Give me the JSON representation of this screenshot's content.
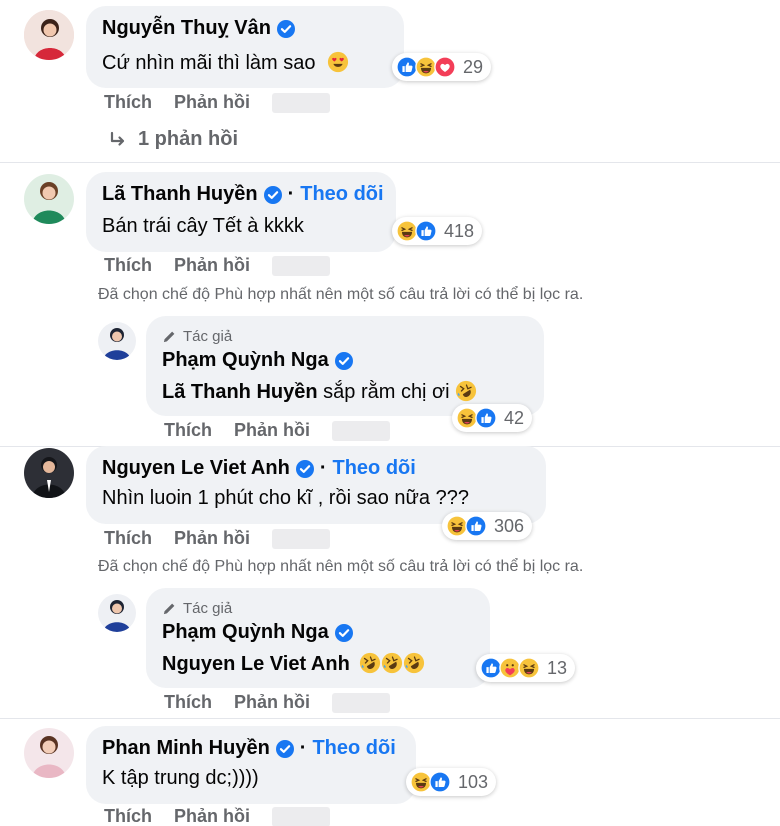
{
  "colors": {
    "accent": "#1877f2",
    "bubble": "#f0f2f5",
    "muted": "#65676b"
  },
  "actions": {
    "like": "Thích",
    "reply": "Phản hồi"
  },
  "filter_note": "Đã chọn chế độ Phù hợp nhất nên một số câu trả lời có thể bị lọc ra.",
  "follow_label": "Theo dõi",
  "author_tag": "Tác giả",
  "comments": [
    {
      "name": "Nguyễn Thuỵ Vân",
      "text": "Cứ nhìn mãi thì làm sao",
      "reactions": [
        "like-icon",
        "haha-icon",
        "love-icon"
      ],
      "count": "29",
      "replies_link": "1 phản hồi"
    },
    {
      "name": "Lã Thanh Huyền",
      "text": "Bán trái cây Tết à kkkk",
      "reactions": [
        "haha-icon",
        "like-icon"
      ],
      "count": "418"
    },
    {
      "name": "Phạm Quỳnh Nga",
      "mention": "Lã Thanh Huyền",
      "text": " sắp rằm chị ơi",
      "reactions": [
        "haha-icon",
        "like-icon"
      ],
      "count": "42"
    },
    {
      "name": "Nguyen Le Viet Anh",
      "text": "Nhìn luoin 1 phút cho kĩ , rồi sao nữa ???",
      "reactions": [
        "haha-icon",
        "like-icon"
      ],
      "count": "306"
    },
    {
      "name": "Phạm Quỳnh Nga",
      "mention": "Nguyen Le Viet Anh",
      "text": "",
      "reactions": [
        "like-icon",
        "care-icon",
        "haha-icon"
      ],
      "count": "13"
    },
    {
      "name": "Phan Minh Huyền",
      "text": "K tập trung dc;))))",
      "reactions": [
        "haha-icon",
        "like-icon"
      ],
      "count": "103"
    }
  ]
}
